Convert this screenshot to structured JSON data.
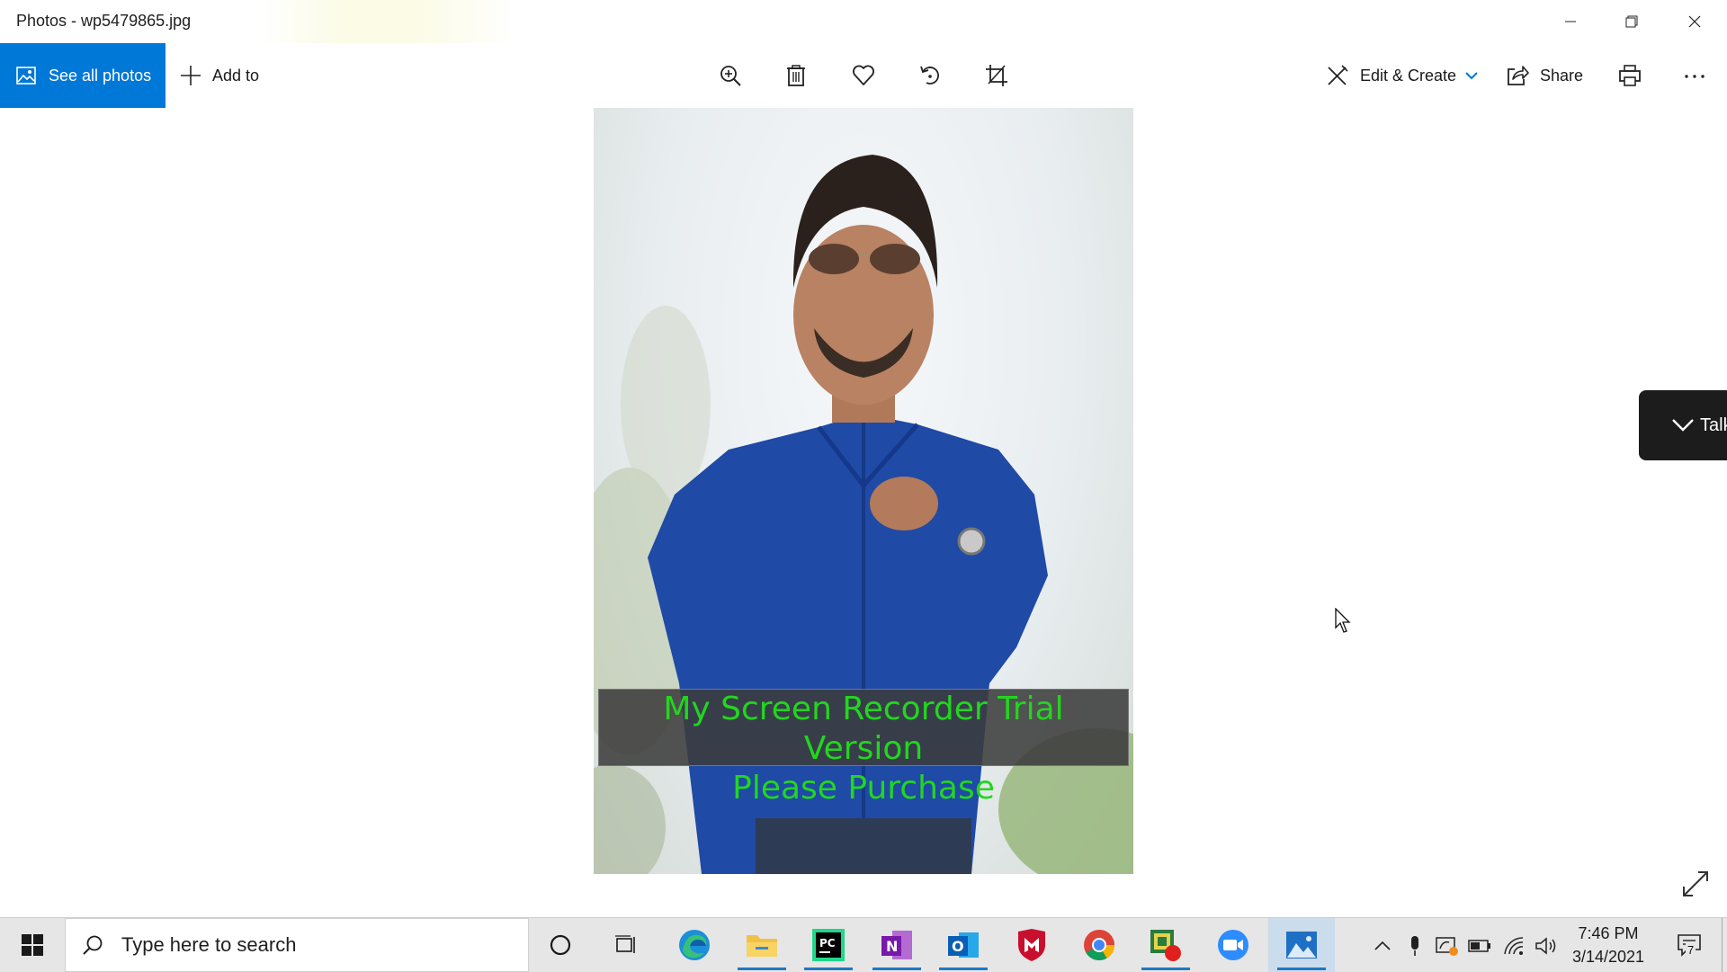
{
  "window": {
    "title": "Photos - wp5479865.jpg",
    "controls": [
      "minimize-icon",
      "restore-icon",
      "close-icon"
    ]
  },
  "toolbar": {
    "see_all_label": "See all photos",
    "add_to_label": "Add to",
    "center_tools": [
      "zoom-icon",
      "delete-icon",
      "favorite-icon",
      "rotate-icon",
      "crop-icon"
    ],
    "edit_create_label": "Edit & Create",
    "share_label": "Share",
    "print_icon": "print-icon",
    "more_icon": "more-icon",
    "accent_color": "#0078d7"
  },
  "content": {
    "watermark_line1": "My Screen Recorder Trial Version",
    "watermark_line2": "Please Purchase",
    "watermark_color": "#22d61f",
    "talk_label": "Talk",
    "expand_icon": "fullscreen-expand-icon"
  },
  "taskbar": {
    "search_placeholder": "Type here to search",
    "apps": [
      "cortana-icon",
      "task-view-icon",
      "edge-icon",
      "file-explorer-icon",
      "pycharm-icon",
      "onenote-icon",
      "outlook-icon",
      "mcafee-icon",
      "chrome-icon",
      "recorder-icon",
      "zoom-icon",
      "photos-icon"
    ],
    "tray": [
      "chevron-up-icon",
      "microphone-icon",
      "defender-icon",
      "battery-icon",
      "wifi-icon",
      "volume-icon"
    ],
    "time": "7:46 PM",
    "date": "3/14/2021",
    "notification_count": "7"
  }
}
